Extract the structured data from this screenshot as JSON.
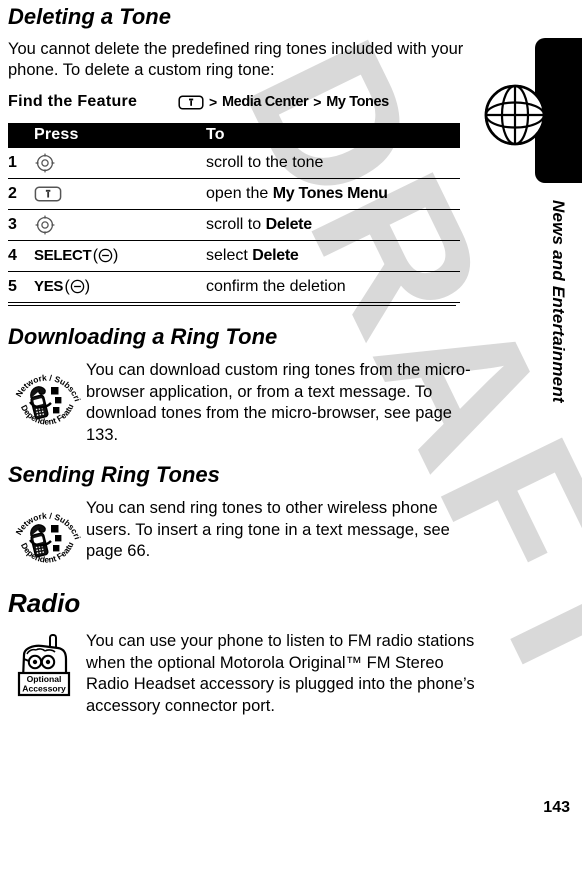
{
  "document": {
    "page_number": "143",
    "side_tab_title": "News and Entertainment",
    "watermark": "DRAFT"
  },
  "sections": [
    {
      "heading": "Deleting a Tone",
      "intro": "You cannot delete the predefined ring tones included with your phone. To delete a custom ring tone:"
    },
    {
      "heading": "Downloading a Ring Tone"
    },
    {
      "heading": "Sending Ring Tones"
    },
    {
      "heading": "Radio"
    }
  ],
  "find_the_feature": {
    "label": "Find the Feature",
    "key_icon": "menu-key-icon",
    "separator": ">",
    "path": [
      "Media Center",
      "My Tones"
    ]
  },
  "steps_table": {
    "headers": {
      "num": "",
      "press": "Press",
      "to": "To"
    },
    "rows": [
      {
        "num": "1",
        "press_icon": "navigation-key-icon",
        "press_label": "",
        "to_prefix": "scroll to the tone",
        "to_bold": "",
        "to_suffix": ""
      },
      {
        "num": "2",
        "press_icon": "menu-key-icon",
        "press_label": "",
        "to_prefix": "open the ",
        "to_bold": "My Tones Menu",
        "to_suffix": ""
      },
      {
        "num": "3",
        "press_icon": "navigation-key-icon",
        "press_label": "",
        "to_prefix": "scroll to ",
        "to_bold": "Delete",
        "to_suffix": ""
      },
      {
        "num": "4",
        "press_icon": "soft-key-icon",
        "press_label": "SELECT",
        "to_prefix": "select ",
        "to_bold": "Delete",
        "to_suffix": ""
      },
      {
        "num": "5",
        "press_icon": "soft-key-icon",
        "press_label": "YES",
        "to_prefix": "confirm the deletion",
        "to_bold": "",
        "to_suffix": ""
      }
    ]
  },
  "notes": [
    {
      "icon": "network-subscription-dependent-feature-icon",
      "icon_text_top": "Network / Subscription",
      "icon_text_bottom": "Dependent Feature",
      "text": "You can download custom ring tones from the micro-browser application, or from a text message. To download tones from the micro-browser, see page 133."
    },
    {
      "icon": "network-subscription-dependent-feature-icon",
      "icon_text_top": "Network / Subscription",
      "icon_text_bottom": "Dependent Feature",
      "text": "You can send ring tones to other wireless phone users. To insert a ring tone in a text message, see page 66."
    },
    {
      "icon": "optional-accessory-icon",
      "icon_text_top": "Optional",
      "icon_text_bottom": "Accessory",
      "text": "You can use your phone to listen to FM radio stations when the optional Motorola Original™ FM Stereo Radio Headset accessory is plugged into the phone’s accessory connector port."
    }
  ],
  "colors": {
    "ink": "#000000",
    "paper": "#ffffff",
    "watermark_gray": "#d9d9d9",
    "table_header_bg": "#000000",
    "table_header_fg": "#ffffff"
  }
}
